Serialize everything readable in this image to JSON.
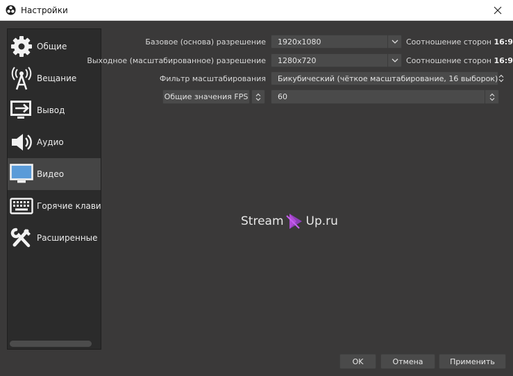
{
  "window": {
    "title": "Настройки",
    "app_icon": "obs-logo-icon",
    "close_icon": "close-icon"
  },
  "sidebar": {
    "items": [
      {
        "label": "Общие",
        "icon": "gear-icon",
        "active": false
      },
      {
        "label": "Вещание",
        "icon": "broadcast-antenna-icon",
        "active": false
      },
      {
        "label": "Вывод",
        "icon": "output-monitor-icon",
        "active": false
      },
      {
        "label": "Аудио",
        "icon": "speaker-icon",
        "active": false
      },
      {
        "label": "Видео",
        "icon": "monitor-icon",
        "active": true
      },
      {
        "label": "Горячие клавиш",
        "icon": "keyboard-icon",
        "active": false
      },
      {
        "label": "Расширенные",
        "icon": "tools-icon",
        "active": false
      }
    ]
  },
  "video": {
    "base_resolution": {
      "label": "Базовое (основа) разрешение",
      "value": "1920x1080",
      "ratio_label": "Соотношение сторон",
      "ratio_value": "16:9"
    },
    "output_resolution": {
      "label": "Выходное (масштабированное) разрешение",
      "value": "1280x720",
      "ratio_label": "Соотношение сторон",
      "ratio_value": "16:9"
    },
    "scale_filter": {
      "label": "Фильтр масштабирования",
      "value": "Бикубический (чёткое масштабирование, 16 выборок)"
    },
    "fps": {
      "label": "Общие значения FPS",
      "value": "60"
    }
  },
  "watermark": {
    "left_text": "Stream",
    "right_text": "Up.ru",
    "accent_color": "#b04bd6"
  },
  "buttons": {
    "ok": "OK",
    "cancel": "Отмена",
    "apply": "Применить"
  }
}
